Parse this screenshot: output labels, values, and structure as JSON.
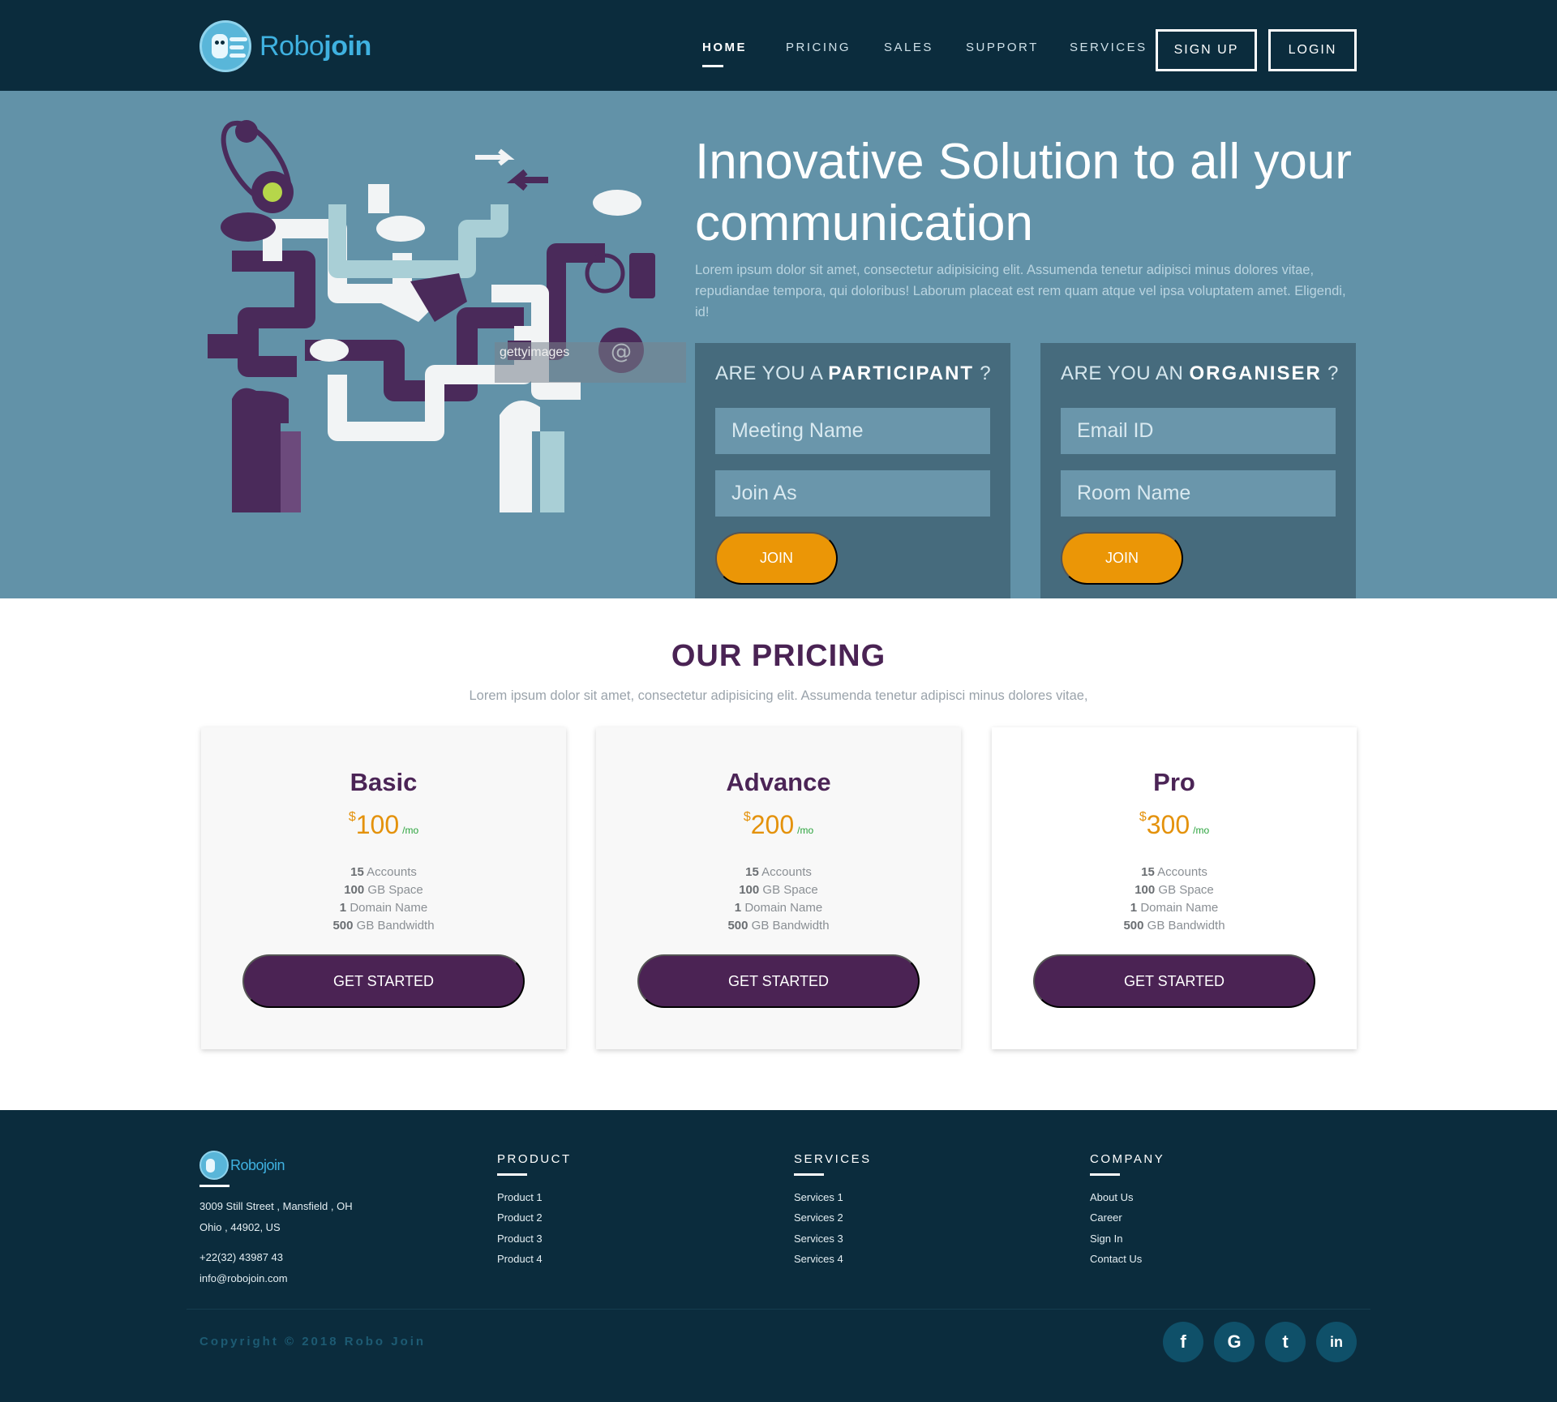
{
  "brand": {
    "name_part1": "Robo",
    "name_part2": "join"
  },
  "nav": {
    "items": [
      {
        "label": "HOME",
        "active": true
      },
      {
        "label": "PRICING",
        "active": false
      },
      {
        "label": "SALES",
        "active": false
      },
      {
        "label": "SUPPORT",
        "active": false
      },
      {
        "label": "SERVICES",
        "active": false
      }
    ],
    "signup_label": "SIGN UP",
    "login_label": "LOGIN"
  },
  "hero": {
    "title": "Innovative Solution to all your communication",
    "description": "Lorem ipsum dolor sit amet, consectetur adipisicing elit. Assumenda tenetur adipisci minus dolores vitae, repudiandae tempora, qui doloribus! Laborum placeat est rem quam atque vel ipsa voluptatem amet. Eligendi, id!",
    "watermark": "gettyimages",
    "participant": {
      "heading_prefix": "ARE YOU A ",
      "heading_strong": "PARTICIPANT",
      "heading_suffix": " ?",
      "field1_placeholder": "Meeting Name",
      "field2_placeholder": "Join As",
      "button": "JOIN"
    },
    "organiser": {
      "heading_prefix": "ARE YOU AN ",
      "heading_strong": "ORGANISER",
      "heading_suffix": " ?",
      "field1_placeholder": "Email ID",
      "field2_placeholder": "Room Name",
      "button": "JOIN"
    }
  },
  "pricing": {
    "title": "OUR PRICING",
    "subtitle": "Lorem ipsum dolor sit amet, consectetur adipisicing elit. Assumenda tenetur adipisci minus dolores vitae,",
    "currency": "$",
    "period": "/mo",
    "plans": [
      {
        "name": "Basic",
        "price": "100",
        "accounts": "15",
        "space": "100",
        "domains": "1",
        "bandwidth": "500",
        "button": "GET STARTED"
      },
      {
        "name": "Advance",
        "price": "200",
        "accounts": "15",
        "space": "100",
        "domains": "1",
        "bandwidth": "500",
        "button": "GET STARTED"
      },
      {
        "name": "Pro",
        "price": "300",
        "accounts": "15",
        "space": "100",
        "domains": "1",
        "bandwidth": "500",
        "button": "GET STARTED"
      }
    ],
    "feature_labels": {
      "accounts": "Accounts",
      "space": "GB Space",
      "domains": "Domain Name",
      "bandwidth": "GB Bandwidth"
    }
  },
  "footer": {
    "address_line1": "3009 Still Street , Mansfield , OH",
    "address_line2": "Ohio , 44902, US",
    "phone": "+22(32) 43987 43",
    "email": "info@robojoin.com",
    "columns": [
      {
        "title": "PRODUCT",
        "links": [
          "Product 1",
          "Product 2",
          "Product 3",
          "Product 4"
        ]
      },
      {
        "title": "SERVICES",
        "links": [
          "Services 1",
          "Services 2",
          "Services 3",
          "Services 4"
        ]
      },
      {
        "title": "COMPANY",
        "links": [
          "About Us",
          "Career",
          "Sign In",
          "Contact Us"
        ]
      }
    ],
    "copyright": "Copyright © 2018 Robo Join",
    "social": [
      {
        "icon": "facebook-icon",
        "glyph": "f"
      },
      {
        "icon": "google-icon",
        "glyph": "G"
      },
      {
        "icon": "twitter-icon",
        "glyph": "t"
      },
      {
        "icon": "linkedin-icon",
        "glyph": "in"
      }
    ]
  },
  "colors": {
    "nav_bg": "#0b2c3d",
    "hero_bg": "#6292a8",
    "form_bg": "#466b7d",
    "accent_orange": "#eb9606",
    "plum": "#4b2354"
  }
}
